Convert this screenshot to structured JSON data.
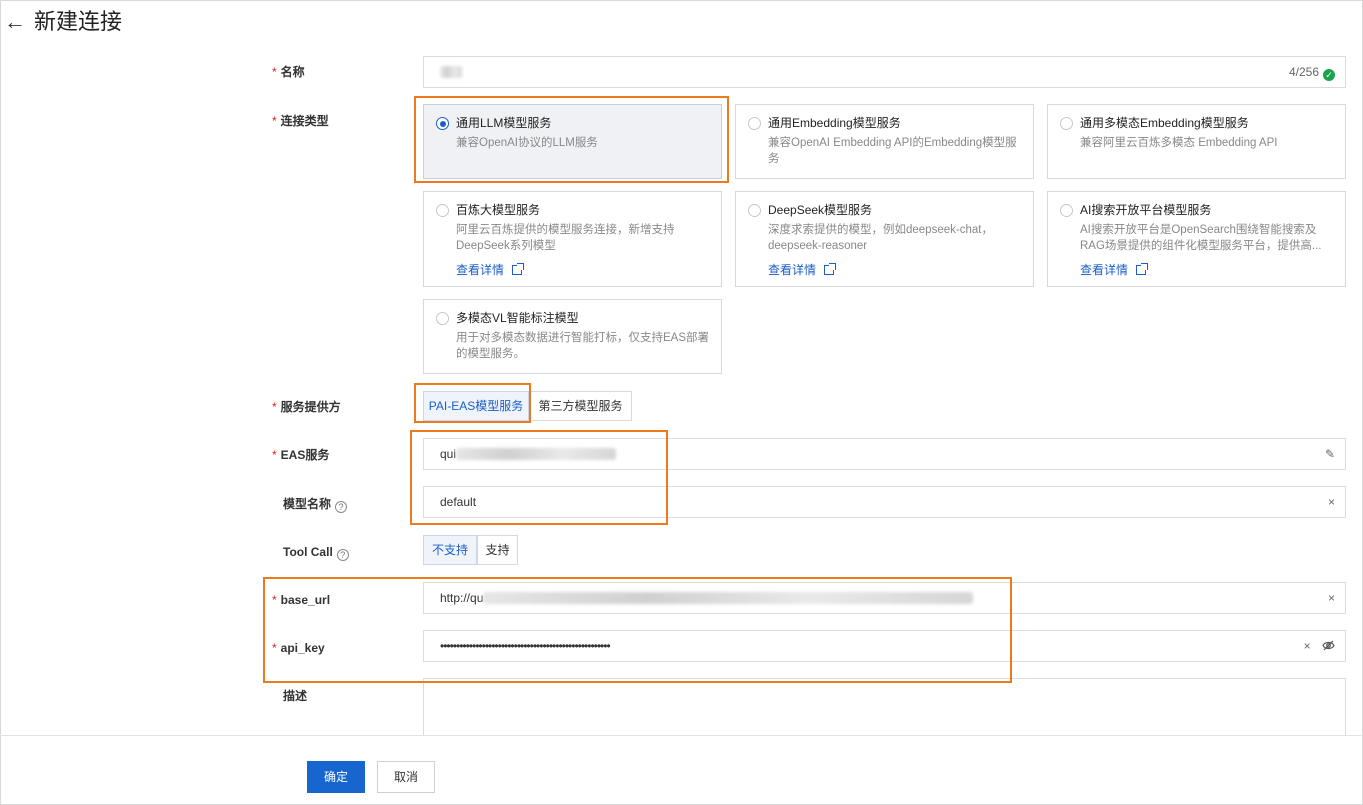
{
  "header": {
    "title": "新建连接",
    "back_icon": "arrow-left-icon"
  },
  "form": {
    "name": {
      "label": "名称",
      "required": "*",
      "count": "4/256"
    },
    "connection_type": {
      "label": "连接类型",
      "required": "*",
      "options": [
        {
          "title": "通用LLM模型服务",
          "desc": "兼容OpenAI协议的LLM服务",
          "selected": true
        },
        {
          "title": "通用Embedding模型服务",
          "desc": "兼容OpenAI Embedding API的Embedding模型服务"
        },
        {
          "title": "通用多模态Embedding模型服务",
          "desc": "兼容阿里云百炼多模态 Embedding API"
        },
        {
          "title": "百炼大模型服务",
          "desc": "阿里云百炼提供的模型服务连接，新增支持DeepSeek系列模型",
          "link": "查看详情"
        },
        {
          "title": "DeepSeek模型服务",
          "desc": "深度求索提供的模型，例如deepseek-chat，deepseek-reasoner",
          "link": "查看详情"
        },
        {
          "title": "AI搜索开放平台模型服务",
          "desc": "AI搜索开放平台是OpenSearch围绕智能搜索及RAG场景提供的组件化模型服务平台，提供高...",
          "link": "查看详情"
        },
        {
          "title": "多模态VL智能标注模型",
          "desc": "用于对多模态数据进行智能打标，仅支持EAS部署的模型服务。"
        }
      ]
    },
    "provider": {
      "label": "服务提供方",
      "required": "*",
      "options": [
        "PAI-EAS模型服务",
        "第三方模型服务"
      ],
      "selected": "PAI-EAS模型服务"
    },
    "eas_service": {
      "label": "EAS服务",
      "required": "*",
      "value_prefix": "qui"
    },
    "model_name": {
      "label": "模型名称",
      "value": "default",
      "help": "?"
    },
    "tool_call": {
      "label": "Tool Call",
      "help": "?",
      "options": [
        "不支持",
        "支持"
      ],
      "selected": "不支持"
    },
    "base_url": {
      "label": "base_url",
      "required": "*",
      "value_prefix": "http://qu"
    },
    "api_key": {
      "label": "api_key",
      "required": "*",
      "value": "•••••••••••••••••••••••••••••••••••••••••••••••••••••"
    },
    "description": {
      "label": "描述"
    },
    "clear_glyph": "×",
    "check_glyph": "✓"
  },
  "footer": {
    "confirm": "确定",
    "cancel": "取消"
  },
  "colors": {
    "accent": "#1766d0",
    "highlight": "#ee7a1e",
    "required": "#e02020",
    "success": "#1aa34a"
  }
}
